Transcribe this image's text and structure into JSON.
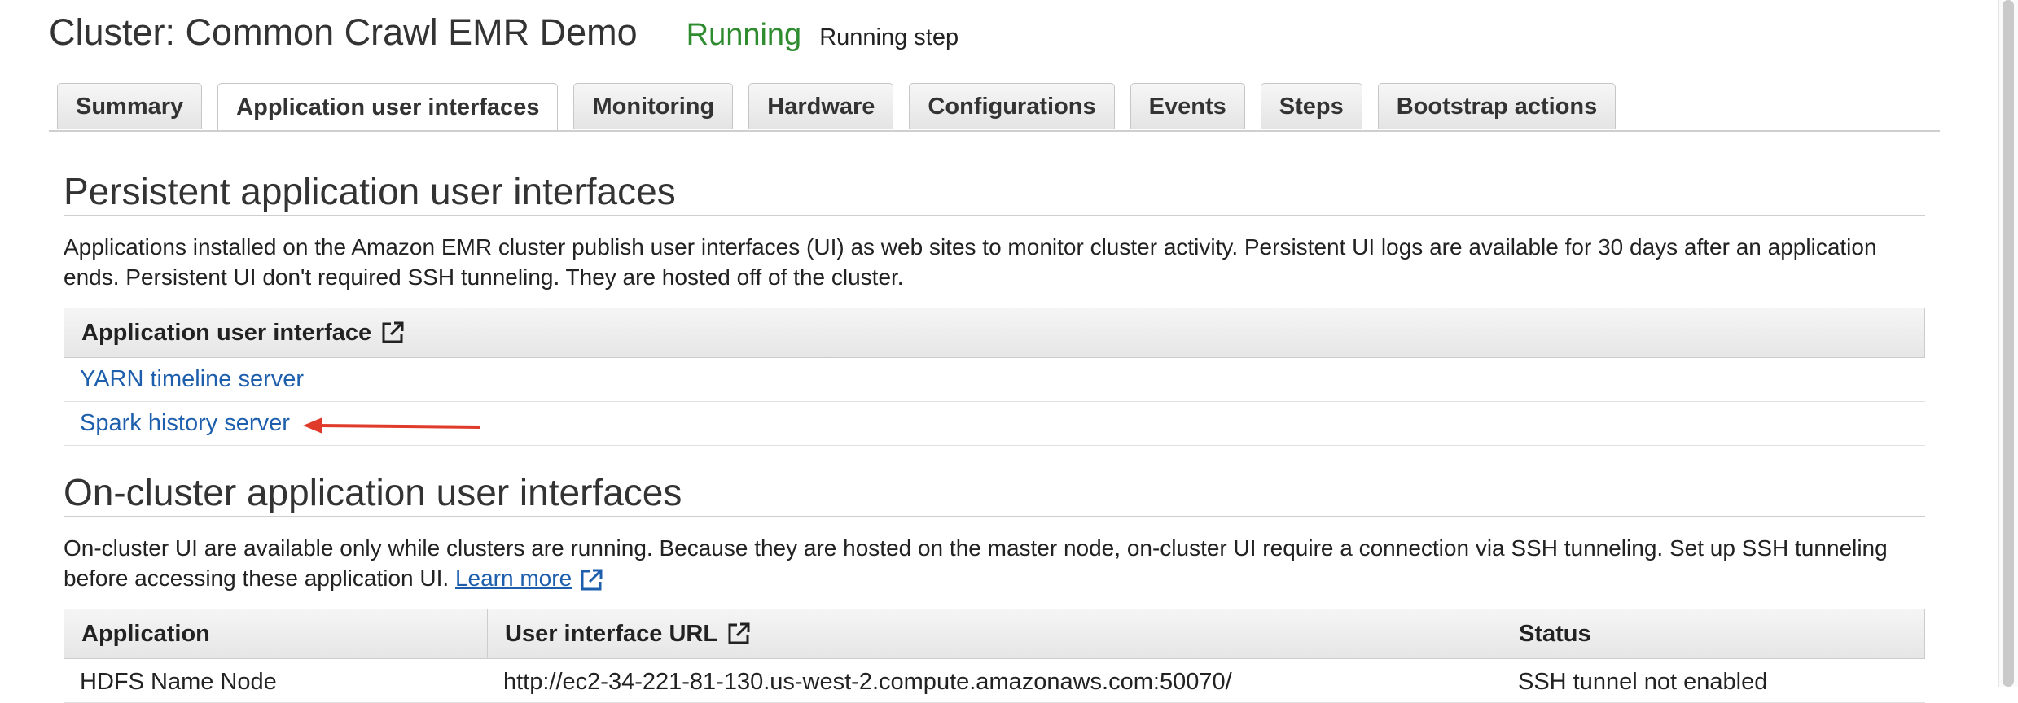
{
  "header": {
    "title": "Cluster: Common Crawl EMR Demo",
    "status": "Running",
    "status_detail": "Running step"
  },
  "tabs": [
    {
      "label": "Summary",
      "active": false
    },
    {
      "label": "Application user interfaces",
      "active": true
    },
    {
      "label": "Monitoring",
      "active": false
    },
    {
      "label": "Hardware",
      "active": false
    },
    {
      "label": "Configurations",
      "active": false
    },
    {
      "label": "Events",
      "active": false
    },
    {
      "label": "Steps",
      "active": false
    },
    {
      "label": "Bootstrap actions",
      "active": false
    }
  ],
  "persistent": {
    "title": "Persistent application user interfaces",
    "description": "Applications installed on the Amazon EMR cluster publish user interfaces (UI) as web sites to monitor cluster activity. Persistent UI logs are available for 30 days after an application ends. Persistent UI don't required SSH tunneling. They are hosted off of the cluster.",
    "table_header": "Application user interface",
    "rows": [
      "YARN timeline server",
      "Spark history server"
    ]
  },
  "oncluster": {
    "title": "On-cluster application user interfaces",
    "description": "On-cluster UI are available only while clusters are running. Because they are hosted on the master node, on-cluster UI require a connection via SSH tunneling. Set up SSH tunneling before accessing these application UI.",
    "learn_more": "Learn more",
    "columns": [
      "Application",
      "User interface URL",
      "Status"
    ],
    "rows": [
      {
        "application": "HDFS Name Node",
        "url": "http://ec2-34-221-81-130.us-west-2.compute.amazonaws.com:50070/",
        "status": "SSH tunnel not enabled"
      }
    ]
  },
  "colors": {
    "running": "#2e8b2e",
    "link": "#1d5fad",
    "annotation_arrow": "#e03a2a"
  },
  "icons": [
    "external-link-icon",
    "annotation-arrow"
  ]
}
